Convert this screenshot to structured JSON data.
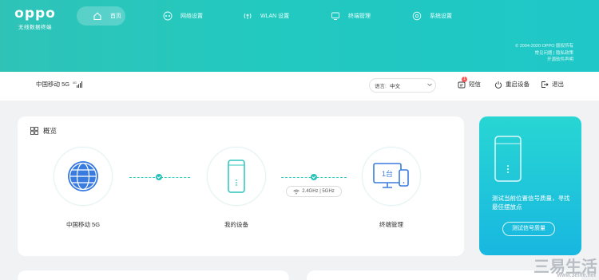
{
  "brand": {
    "logo_text": "oppo",
    "subtitle": "无线数据终端"
  },
  "nav": [
    {
      "label": "首页",
      "icon": "home-icon",
      "active": true
    },
    {
      "label": "网络设置",
      "icon": "network-icon",
      "active": false
    },
    {
      "label": "WLAN 设置",
      "icon": "wifi-icon",
      "active": false
    },
    {
      "label": "终端管理",
      "icon": "monitor-icon",
      "active": false
    },
    {
      "label": "系统设置",
      "icon": "gear-icon",
      "active": false
    }
  ],
  "header_right": {
    "copyright": "© 2004-2020 OPPO 版权所有",
    "links": "常见问题 | 隐私政策",
    "license": "开源软件声明"
  },
  "status": {
    "carrier": "中国移动 5G",
    "signal_label": "4G",
    "language_label": "语言:",
    "language_value": "中文",
    "sms_label": "短信",
    "sms_badge": "1",
    "restart_label": "重启设备",
    "logout_label": "退出"
  },
  "overview": {
    "title": "概览",
    "nodes": [
      {
        "label": "中国移动 5G",
        "icon": "globe-icon"
      },
      {
        "label": "我的设备",
        "icon": "router-icon"
      },
      {
        "label": "终端管理",
        "icon": "devices-icon",
        "device_count": "1台"
      }
    ],
    "band_label": "2.4GHz | 5GHz"
  },
  "side_card": {
    "text": "测试当前位置信号质量，寻找最佳摆放点",
    "button": "测试信号质量"
  },
  "watermark": {
    "big": "三易生活",
    "small": "www.3elife.net"
  },
  "colors": {
    "accent": "#26c2b8",
    "header_start": "#2fc3b8",
    "header_end": "#1fc7c8"
  }
}
